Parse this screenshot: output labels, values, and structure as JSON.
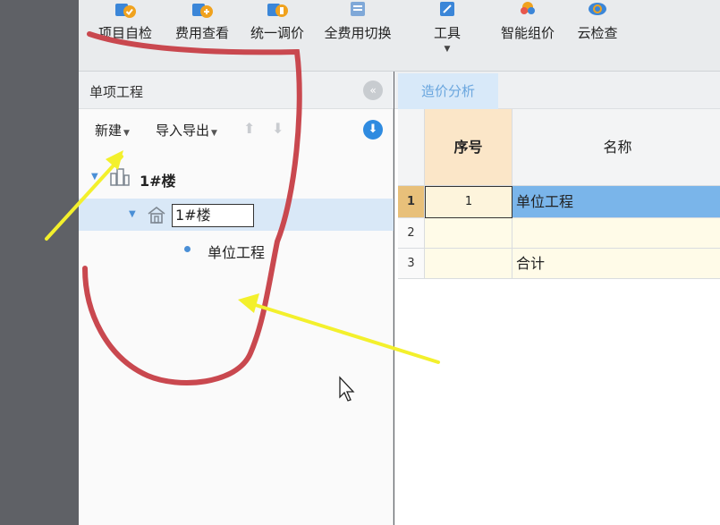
{
  "toolbar": {
    "buttons": [
      {
        "label": "项目自检",
        "icon": "project-check-icon"
      },
      {
        "label": "费用查看",
        "icon": "cost-view-icon"
      },
      {
        "label": "统一调价",
        "icon": "unified-price-icon"
      },
      {
        "label": "全费用切换",
        "icon": "full-cost-switch-icon"
      },
      {
        "label": "工具",
        "icon": "tools-icon"
      },
      {
        "label": "智能组价",
        "icon": "smart-pricing-icon"
      },
      {
        "label": "云检查",
        "icon": "cloud-check-icon"
      }
    ]
  },
  "panel": {
    "title": "单项工程",
    "new_label": "新建",
    "import_export_label": "导入导出"
  },
  "tree": {
    "root_label": "1#楼",
    "child_value": "1#楼",
    "leaf_label": "单位工程"
  },
  "main": {
    "tab_label": "造价分析",
    "columns": [
      "序号",
      "名称"
    ],
    "rows": [
      {
        "num": "1",
        "seq": "1",
        "name": "单位工程"
      },
      {
        "num": "2",
        "seq": "",
        "name": ""
      },
      {
        "num": "3",
        "seq": "",
        "name": "合计"
      }
    ]
  },
  "colors": {
    "accent": "#2f8be0",
    "selection": "#7ab5ea",
    "annotation_red": "#c9484f",
    "annotation_yellow": "#f3f02c"
  }
}
